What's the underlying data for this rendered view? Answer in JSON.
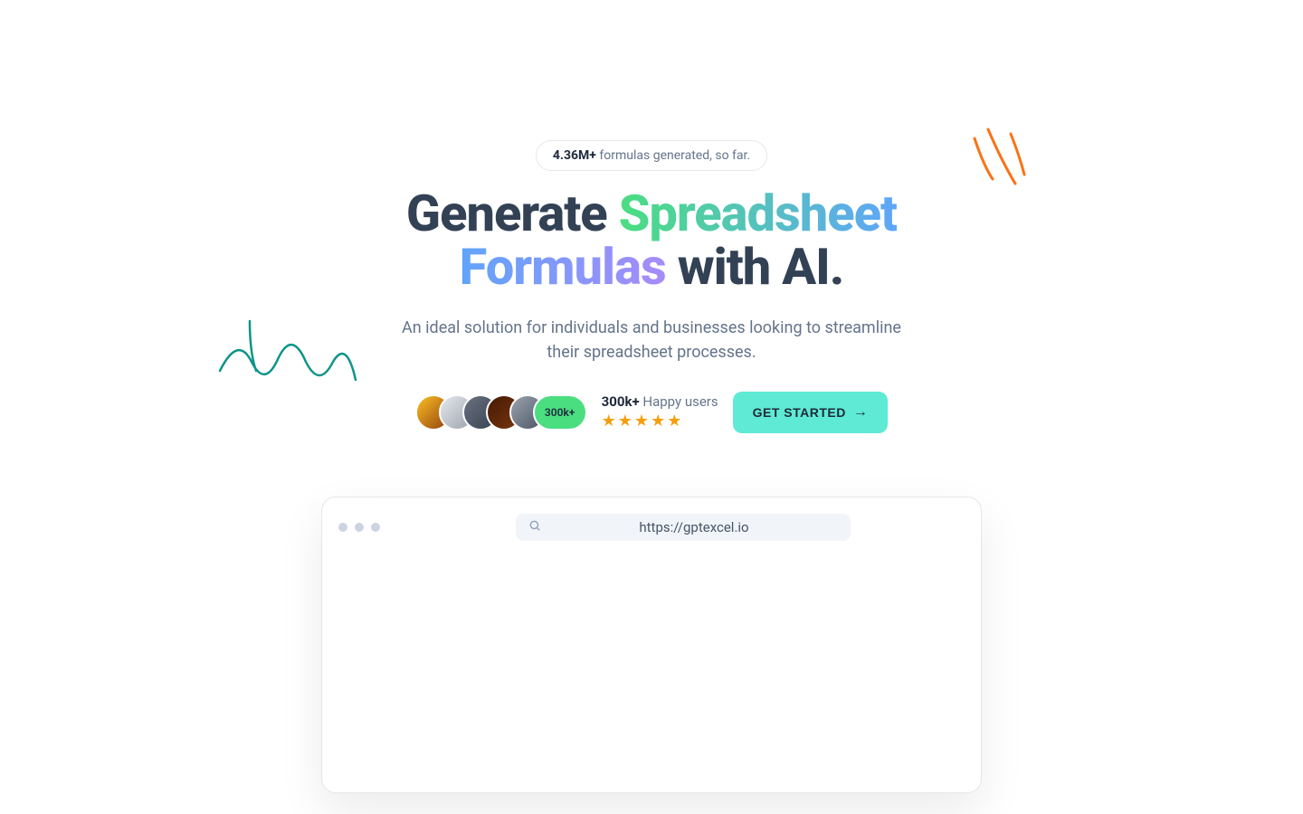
{
  "badge": {
    "count": "4.36M+",
    "text": " formulas generated, so far."
  },
  "headline": {
    "part1": "Generate ",
    "highlight1": "Spreadsheet",
    "highlight2": "Formulas",
    "part2": " with AI."
  },
  "subtitle": "An ideal solution for individuals and businesses looking to streamline their spreadsheet processes.",
  "avatarPill": "300k+",
  "userStats": {
    "count": "300k+",
    "label": " Happy users"
  },
  "cta": "GET STARTED",
  "browserUrl": "https://gptexcel.io"
}
